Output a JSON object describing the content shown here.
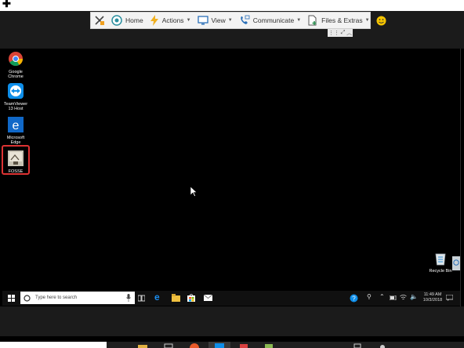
{
  "toolbar": {
    "home_label": "Home",
    "actions_label": "Actions",
    "view_label": "View",
    "communicate_label": "Communicate",
    "files_label": "Files & Extras"
  },
  "desktop": {
    "icons": [
      {
        "line1": "Google",
        "line2": "Chrome"
      },
      {
        "line1": "TeamViewer",
        "line2": "13 Host"
      },
      {
        "line1": "Microsoft",
        "line2": "Edge"
      },
      {
        "line1": "FOSSE",
        "line2": ""
      }
    ],
    "recycle_label": "Recycle Bin"
  },
  "taskbar": {
    "search_placeholder": "Type here to search",
    "time": "11:49 AM",
    "date": "10/3/2018"
  },
  "colors": {
    "highlight": "#dd3333",
    "toolbar_bg": "#f3f3f3",
    "accent_blue": "#1a73e8"
  }
}
